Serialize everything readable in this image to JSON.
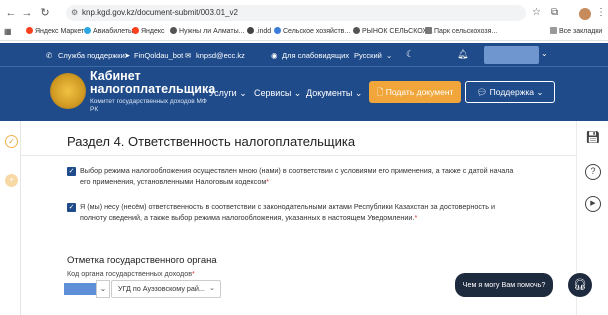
{
  "browser": {
    "url": "knp.kgd.gov.kz/document-submit/003.01_v2",
    "bookmarks": [
      "Яндекс Маркет",
      "Авиабилеты",
      "Яндекс",
      "Нужны ли Алматы...",
      ".indd",
      "Сельское хозяйств...",
      "РЫНОК СЕЛЬСКОХ...",
      "Парк сельскохозя...",
      "Все закладки"
    ]
  },
  "topbar": {
    "support": "Служба поддержки",
    "bot": "FinQoldau_bot",
    "email": "knpsd@ecc.kz",
    "accessibility": "Для слабовидящих",
    "language": "Русский"
  },
  "brand": {
    "line1": "Кабинет",
    "line2": "налогоплательщика",
    "line3": "Комитет государственных доходов МФ РК"
  },
  "nav": {
    "services": "Услуги",
    "e_services": "Сервисы",
    "documents": "Документы",
    "submit_button": "Подать документ",
    "support_button": "Поддержка"
  },
  "main": {
    "section_title": "Раздел 4. Ответственность налогоплательщика",
    "check1": "Выбор режима налогообложения осуществлен мною (нами) в соответствии с условиями его применения, а также с датой начала его применения, установленными Налоговым кодексом",
    "check2": "Я (мы) несу (несём) ответственность в соответствии с законодательными актами Республики Казахстан за достоверность и полноту сведений, а также выбор режима налогообложения, указанных в настоящем Уведомлении.",
    "org_section": "Отметка государственного органа",
    "org_code_label": "Код органа государственных доходов",
    "org_select_value": "УГД по Ауэзовскому рай...",
    "chat_text": "Чем я могу Вам помочь?"
  },
  "colors": {
    "header": "#1f4b8a",
    "accent": "#f0a63a",
    "chat": "#1e2a3e"
  }
}
